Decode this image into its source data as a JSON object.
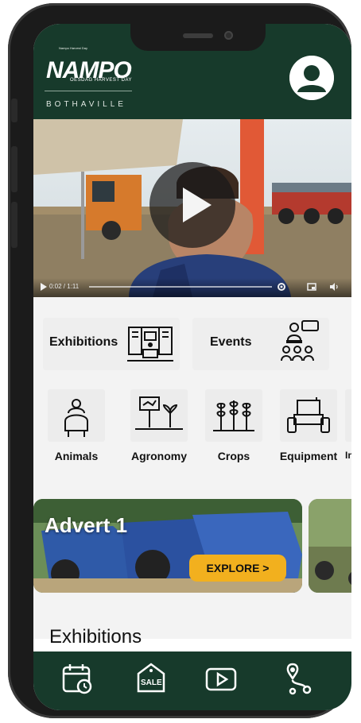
{
  "header": {
    "logo_small": "Nampo Harvest Day",
    "logo": "NAMPO",
    "logo_sub": "OESDAG HARVEST DAY",
    "location": "BOTHAVILLE"
  },
  "video": {
    "time": "0:02 / 1:11"
  },
  "main_categories": [
    {
      "label": "Exhibitions",
      "icon": "exhibition-booth-icon"
    },
    {
      "label": "Events",
      "icon": "presentation-audience-icon"
    }
  ],
  "categories": [
    {
      "label": "Animals",
      "icon": "livestock-icon"
    },
    {
      "label": "Agronomy",
      "icon": "agronomy-sign-plant-icon"
    },
    {
      "label": "Crops",
      "icon": "crops-icon"
    },
    {
      "label": "Equipment",
      "icon": "tractor-icon"
    },
    {
      "label": "Infr"
    }
  ],
  "advert": {
    "title": "Advert 1",
    "button": "EXPLORE >"
  },
  "exhibitions_heading": "Exhibitions",
  "bottom_nav": [
    {
      "icon": "calendar-clock-icon"
    },
    {
      "icon": "sale-tag-icon",
      "label": "SALE"
    },
    {
      "icon": "video-play-icon"
    },
    {
      "icon": "route-map-icon"
    }
  ],
  "colors": {
    "brand_green": "#173a2b",
    "accent_yellow": "#f2b01e"
  }
}
